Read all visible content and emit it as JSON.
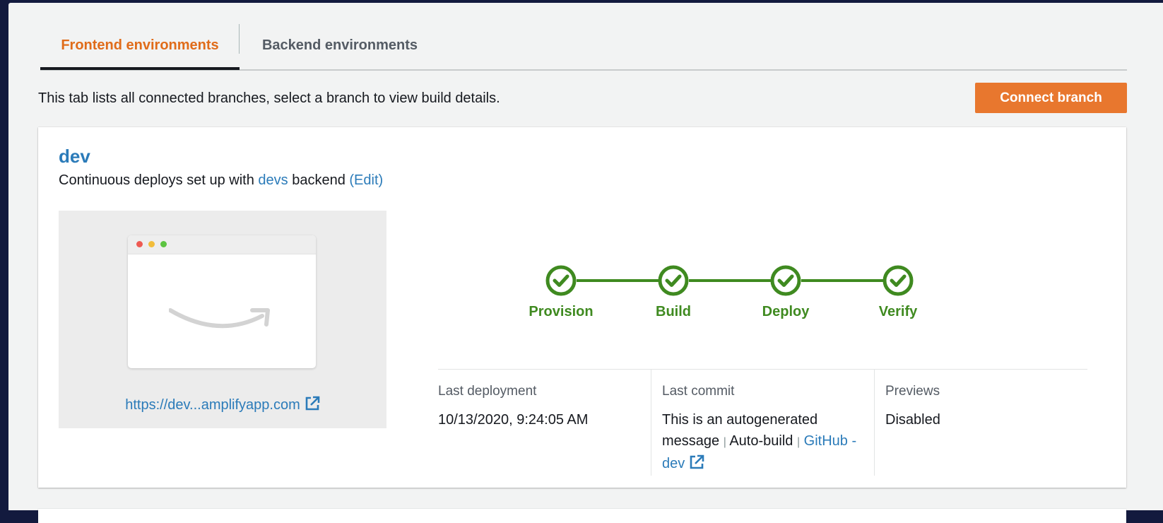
{
  "tabs": [
    {
      "label": "Frontend environments",
      "active": true
    },
    {
      "label": "Backend environments",
      "active": false
    }
  ],
  "description": "This tab lists all connected branches, select a branch to view build details.",
  "connect_button": "Connect branch",
  "branch": {
    "name": "dev",
    "subtitle_prefix": "Continuous deploys set up with ",
    "backend_link": "devs",
    "subtitle_mid": " backend ",
    "edit_link": "(Edit)",
    "preview_url": "https://dev...amplifyapp.com"
  },
  "pipeline": {
    "steps": [
      "Provision",
      "Build",
      "Deploy",
      "Verify"
    ]
  },
  "info": {
    "last_deployment": {
      "label": "Last deployment",
      "value": "10/13/2020, 9:24:05 AM"
    },
    "last_commit": {
      "label": "Last commit",
      "message": "This is an autogenerated message",
      "separator": "|",
      "trigger": "Auto-build",
      "repo_link": "GitHub - dev"
    },
    "previews": {
      "label": "Previews",
      "value": "Disabled"
    }
  },
  "colors": {
    "accent_orange": "#e8772e",
    "tab_active": "#e06c1a",
    "link_blue": "#2b7bb9",
    "success_green": "#3f8a20",
    "background_navy": "#131a3e"
  }
}
